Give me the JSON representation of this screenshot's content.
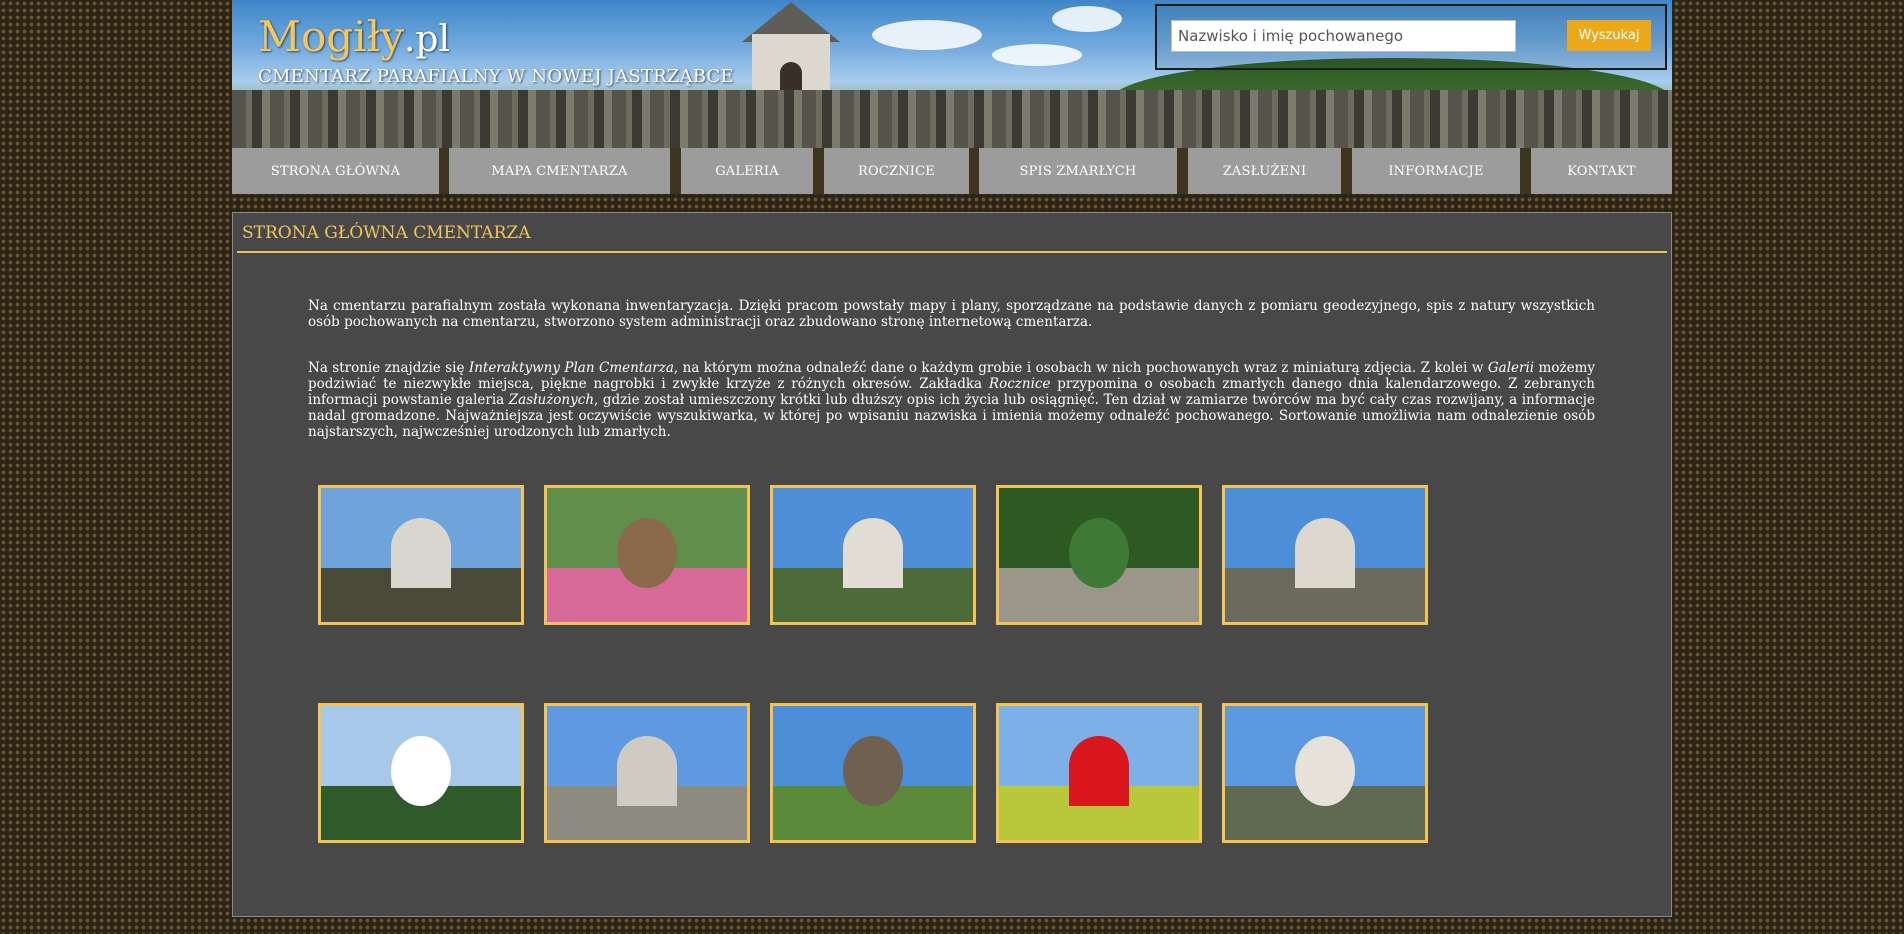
{
  "header": {
    "logo_main": "Mogiły",
    "logo_suffix": ".pl",
    "subtitle": "CMENTARZ PARAFIALNY W NOWEJ JASTRZĄBCE",
    "search_placeholder": "Nazwisko i imię pochowanego",
    "search_value": "",
    "search_button": "Wyszukaj"
  },
  "nav": [
    {
      "label": "STRONA GŁÓWNA"
    },
    {
      "label": "MAPA CMENTARZA"
    },
    {
      "label": "GALERIA"
    },
    {
      "label": "ROCZNICE"
    },
    {
      "label": "SPIS ZMARŁYCH"
    },
    {
      "label": "ZASŁUŻENI"
    },
    {
      "label": "INFORMACJE"
    },
    {
      "label": "KONTAKT"
    }
  ],
  "main": {
    "title": "STRONA GŁÓWNA CMENTARZA",
    "p1": "Na cmentarzu parafialnym została wykonana inwentaryzacja. Dzięki pracom powstały mapy i plany, sporządzane na podstawie danych z pomiaru geodezyjnego, spis z natury wszystkich osób pochowanych na cmentarzu, stworzono system administracji oraz zbudowano stronę internetową cmentarza.",
    "p2_a": "Na stronie znajdzie się ",
    "p2_b": "Interaktywny Plan Cmentarza",
    "p2_c": ", na którym można odnaleźć dane o każdym grobie i osobach w nich pochowanych wraz z miniaturą zdjęcia. Z kolei w ",
    "p2_d": "Galerii",
    "p2_e": " możemy podziwiać te niezwykłe miejsca, piękne nagrobki i zwykłe krzyże z różnych okresów. Zakładka ",
    "p2_f": "Rocznice",
    "p2_g": " przypomina o osobach zmarłych danego dnia kalendarzowego. Z zebranych informacji powstanie galeria ",
    "p2_h": "Zasłużonych",
    "p2_i": ", gdzie został umieszczony krótki lub dłuższy opis ich życia lub osiągnięć.  Ten dział w zamiarze twórców ma być cały czas rozwijany, a informacje nadal gromadzone. Najważniejsza jest oczywiście wyszukiwarka, w której po wpisaniu nazwiska i imienia możemy odnaleźć pochowanego. Sortowanie umożliwia nam odnalezienie osób najstarszych, najwcześniej urodzonych lub zmarłych."
  },
  "gallery": [
    {
      "subject": "cemetery-panorama",
      "sky": "#6ea3dc",
      "land": "#4a4a3a",
      "obj": "#d8d6cf"
    },
    {
      "subject": "christ-sculpture-flowers",
      "sky": "#5f8f4a",
      "land": "#d86a9a",
      "obj": "#8a6a4a"
    },
    {
      "subject": "chapel-front",
      "sky": "#4f8fd8",
      "land": "#4e6b3a",
      "obj": "#e2ddd2"
    },
    {
      "subject": "cemetery-alley-trees",
      "sky": "#2d5a22",
      "land": "#9a968a",
      "obj": "#3e7a35"
    },
    {
      "subject": "chapel-side",
      "sky": "#4d8ed9",
      "land": "#6c6a5c",
      "obj": "#dcd8ce"
    },
    {
      "subject": "white-flowers",
      "sky": "#a8c8ea",
      "land": "#2f5a2a",
      "obj": "#ffffff"
    },
    {
      "subject": "graves-and-chapel",
      "sky": "#5f9ae0",
      "land": "#8d8b80",
      "obj": "#cfcbc2"
    },
    {
      "subject": "madonna-statue",
      "sky": "#4d8ed9",
      "land": "#5b8a3a",
      "obj": "#6e6150"
    },
    {
      "subject": "red-rose",
      "sky": "#7cb0e6",
      "land": "#b8c83a",
      "obj": "#d8161c"
    },
    {
      "subject": "chapel-gable",
      "sky": "#5d99df",
      "land": "#5f6a50",
      "obj": "#e6e2da"
    }
  ]
}
